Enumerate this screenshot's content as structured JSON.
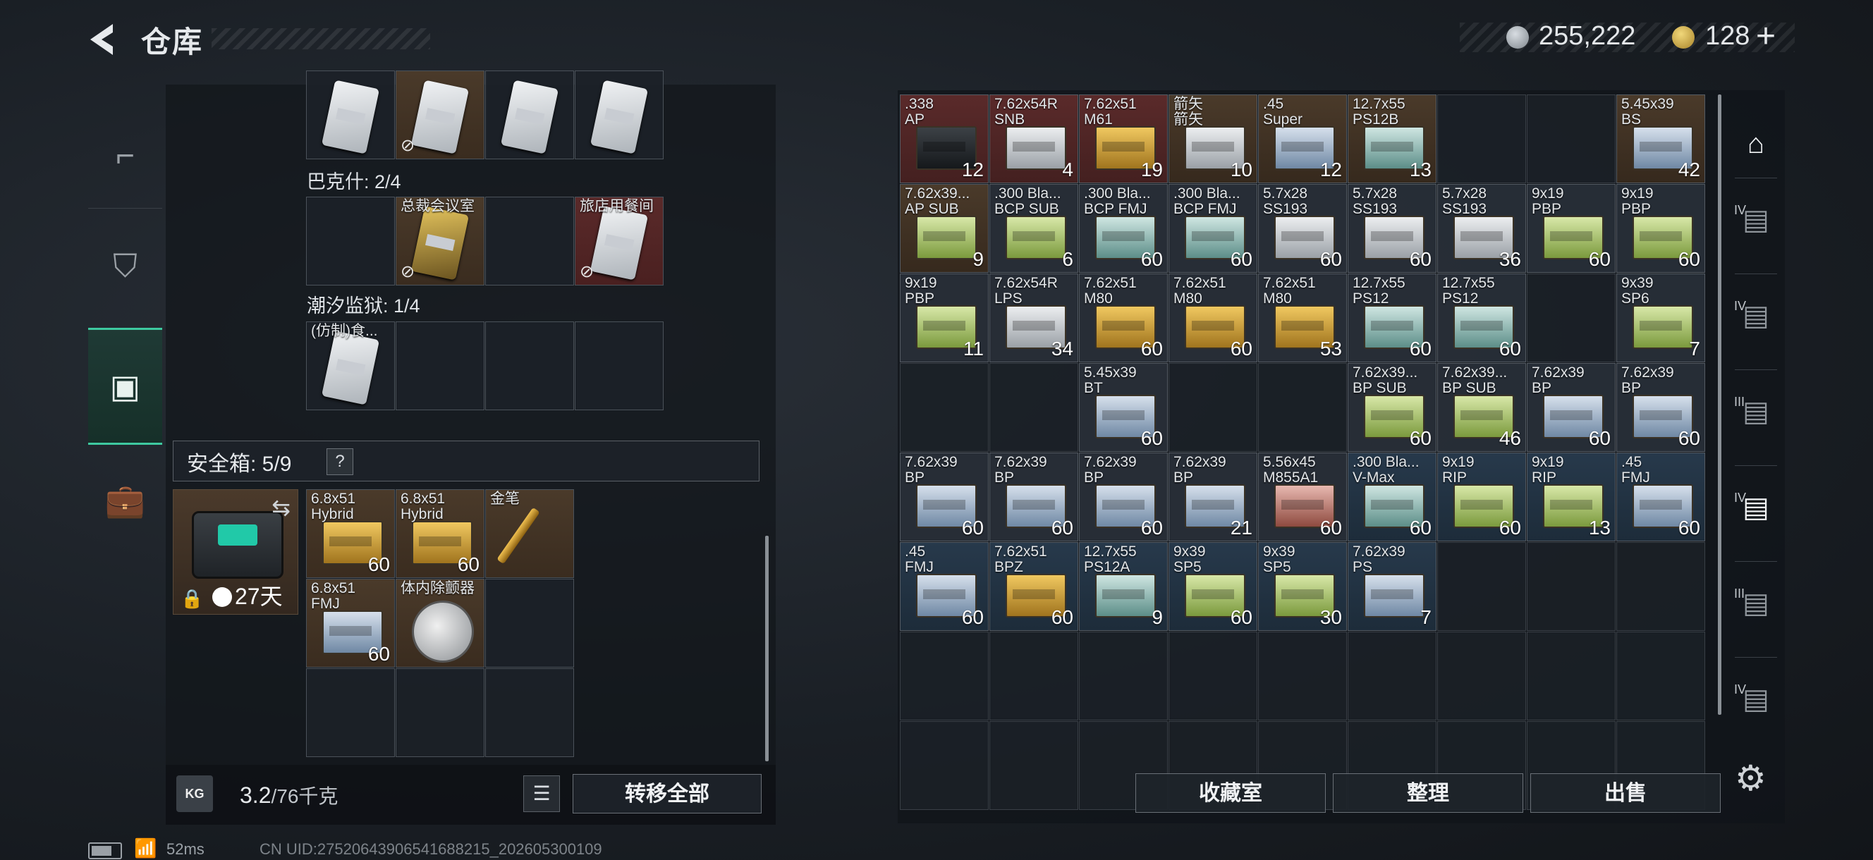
{
  "header": {
    "title": "仓库",
    "silver": "255,222",
    "gold": "128",
    "plus": "+"
  },
  "left_tabs": [
    {
      "name": "weapon",
      "icon": "pistol-icon"
    },
    {
      "name": "gear",
      "icon": "armor-icon"
    },
    {
      "name": "backpack",
      "icon": "backpack-icon"
    },
    {
      "name": "case",
      "icon": "briefcase-icon"
    }
  ],
  "keys": {
    "top_row": [
      {
        "bg": "dark",
        "nolink": false
      },
      {
        "bg": "brown",
        "nolink": true
      },
      {
        "bg": "dark",
        "nolink": false
      },
      {
        "bg": "dark",
        "nolink": false
      }
    ],
    "bakshi": {
      "label": "巴克什: 2/4",
      "cells": [
        {
          "label": "",
          "empty": true
        },
        {
          "label": "总裁会议室",
          "bg": "brown",
          "card": "gold",
          "nolink": true
        },
        {
          "label": "",
          "empty": true
        },
        {
          "label": "旅店用餐间",
          "bg": "red",
          "card": "white",
          "nolink": true
        }
      ]
    },
    "tidal_prison": {
      "label": "潮汐监狱: 1/4",
      "cells": [
        {
          "label": "(仿制)食...",
          "bg": "dark",
          "card": "white"
        },
        {
          "label": "",
          "empty": true
        },
        {
          "label": "",
          "empty": true
        },
        {
          "label": "",
          "empty": true
        }
      ]
    }
  },
  "safe_box": {
    "label": "安全箱: 5/9",
    "help": "?",
    "timer": "27天",
    "items": [
      {
        "label": "6.8x51\nHybrid",
        "count": "60",
        "box": "gold"
      },
      {
        "label": "6.8x51\nHybrid",
        "count": "60",
        "box": "gold"
      },
      {
        "label": "金笔",
        "count": "",
        "box": "pen"
      },
      {
        "label": "6.8x51\nFMJ",
        "count": "60",
        "box": "blue"
      },
      {
        "label": "体内除颤器",
        "count": "",
        "box": "detector"
      }
    ]
  },
  "bottom_left": {
    "weight": "3.2",
    "weight_max": "/76千克",
    "weight_badge": "KG",
    "transfer_all": "转移全部"
  },
  "bottom_right": {
    "collection": "收藏室",
    "organize": "整理",
    "sell": "出售"
  },
  "stash_grid": [
    [
      {
        "l": ".338\nAP",
        "c": "12",
        "bg": "red",
        "box": "black"
      },
      {
        "l": "7.62x54R\nSNB",
        "c": "4",
        "bg": "red",
        "box": "white"
      },
      {
        "l": "7.62x51\nM61",
        "c": "19",
        "bg": "red",
        "box": "gold"
      },
      {
        "l": "箭矢\n箭矢",
        "c": "10",
        "bg": "brown",
        "box": "white"
      },
      {
        "l": ".45\nSuper",
        "c": "12",
        "bg": "brown",
        "box": "blue"
      },
      {
        "l": "12.7x55\nPS12B",
        "c": "13",
        "bg": "brown",
        "box": "teal"
      },
      null,
      null,
      {
        "l": "5.45x39\nBS",
        "c": "42",
        "bg": "brown",
        "box": "blue"
      }
    ],
    [
      {
        "l": "7.62x39...\nAP SUB",
        "c": "9",
        "bg": "brown",
        "box": "green"
      },
      {
        "l": ".300 Bla...\nBCP SUB",
        "c": "6",
        "bg": "dark",
        "box": "green"
      },
      {
        "l": ".300 Bla...\nBCP FMJ",
        "c": "60",
        "bg": "dark",
        "box": "teal"
      },
      {
        "l": ".300 Bla...\nBCP FMJ",
        "c": "60",
        "bg": "dark",
        "box": "teal"
      },
      {
        "l": "5.7x28\nSS193",
        "c": "60",
        "bg": "dark",
        "box": "white"
      },
      {
        "l": "5.7x28\nSS193",
        "c": "60",
        "bg": "dark",
        "box": "white"
      },
      {
        "l": "5.7x28\nSS193",
        "c": "36",
        "bg": "dark",
        "box": "white"
      },
      {
        "l": "9x19\nPBP",
        "c": "60",
        "bg": "dark",
        "box": "green"
      },
      {
        "l": "9x19\nPBP",
        "c": "60",
        "bg": "dark",
        "box": "green"
      }
    ],
    [
      {
        "l": "9x19\nPBP",
        "c": "11",
        "bg": "dark",
        "box": "green"
      },
      {
        "l": "7.62x54R\nLPS",
        "c": "34",
        "bg": "dark",
        "box": "white"
      },
      {
        "l": "7.62x51\nM80",
        "c": "60",
        "bg": "dark",
        "box": "gold"
      },
      {
        "l": "7.62x51\nM80",
        "c": "60",
        "bg": "dark",
        "box": "gold"
      },
      {
        "l": "7.62x51\nM80",
        "c": "53",
        "bg": "dark",
        "box": "gold"
      },
      {
        "l": "12.7x55\nPS12",
        "c": "60",
        "bg": "dark",
        "box": "teal"
      },
      {
        "l": "12.7x55\nPS12",
        "c": "60",
        "bg": "dark",
        "box": "teal"
      },
      null,
      {
        "l": "9x39\nSP6",
        "c": "7",
        "bg": "dark",
        "box": "green"
      }
    ],
    [
      null,
      null,
      {
        "l": "5.45x39\nBT",
        "c": "60",
        "bg": "dark",
        "box": "blue"
      },
      null,
      null,
      {
        "l": "7.62x39...\nBP SUB",
        "c": "60",
        "bg": "dark",
        "box": "green"
      },
      {
        "l": "7.62x39...\nBP SUB",
        "c": "46",
        "bg": "dark",
        "box": "green"
      },
      {
        "l": "7.62x39\nBP",
        "c": "60",
        "bg": "dark",
        "box": "blue"
      },
      {
        "l": "7.62x39\nBP",
        "c": "60",
        "bg": "dark",
        "box": "blue"
      }
    ],
    [
      {
        "l": "7.62x39\nBP",
        "c": "60",
        "bg": "dark",
        "box": "blue"
      },
      {
        "l": "7.62x39\nBP",
        "c": "60",
        "bg": "dark",
        "box": "blue"
      },
      {
        "l": "7.62x39\nBP",
        "c": "60",
        "bg": "dark",
        "box": "blue"
      },
      {
        "l": "7.62x39\nBP",
        "c": "21",
        "bg": "dark",
        "box": "blue"
      },
      {
        "l": "5.56x45\nM855A1",
        "c": "60",
        "bg": "dark",
        "box": "red"
      },
      {
        "l": ".300 Bla...\nV-Max",
        "c": "60",
        "bg": "slate",
        "box": "teal"
      },
      {
        "l": "9x19\nRIP",
        "c": "60",
        "bg": "slate",
        "box": "green"
      },
      {
        "l": "9x19\nRIP",
        "c": "13",
        "bg": "slate",
        "box": "green"
      },
      {
        "l": ".45\nFMJ",
        "c": "60",
        "bg": "slate",
        "box": "blue"
      }
    ],
    [
      {
        "l": ".45\nFMJ",
        "c": "60",
        "bg": "slate",
        "box": "blue"
      },
      {
        "l": "7.62x51\nBPZ",
        "c": "60",
        "bg": "slate",
        "box": "gold"
      },
      {
        "l": "12.7x55\nPS12A",
        "c": "9",
        "bg": "slate",
        "box": "teal"
      },
      {
        "l": "9x39\nSP5",
        "c": "60",
        "bg": "slate",
        "box": "green"
      },
      {
        "l": "9x39\nSP5",
        "c": "30",
        "bg": "slate",
        "box": "green"
      },
      {
        "l": "7.62x39\nPS",
        "c": "7",
        "bg": "slate",
        "box": "blue"
      },
      null,
      null,
      null
    ]
  ],
  "filters": [
    "IV",
    "IV",
    "III",
    "IV",
    "III",
    "IV"
  ],
  "status": {
    "ping": "52ms",
    "uid": "CN UID:2752064390654168821​5_202605300109"
  },
  "colors": {
    "accent": "#3ec9a0",
    "red_cell": "#5a2a2a",
    "brown_cell": "#4a3a2a",
    "slate_cell": "#24384a"
  }
}
